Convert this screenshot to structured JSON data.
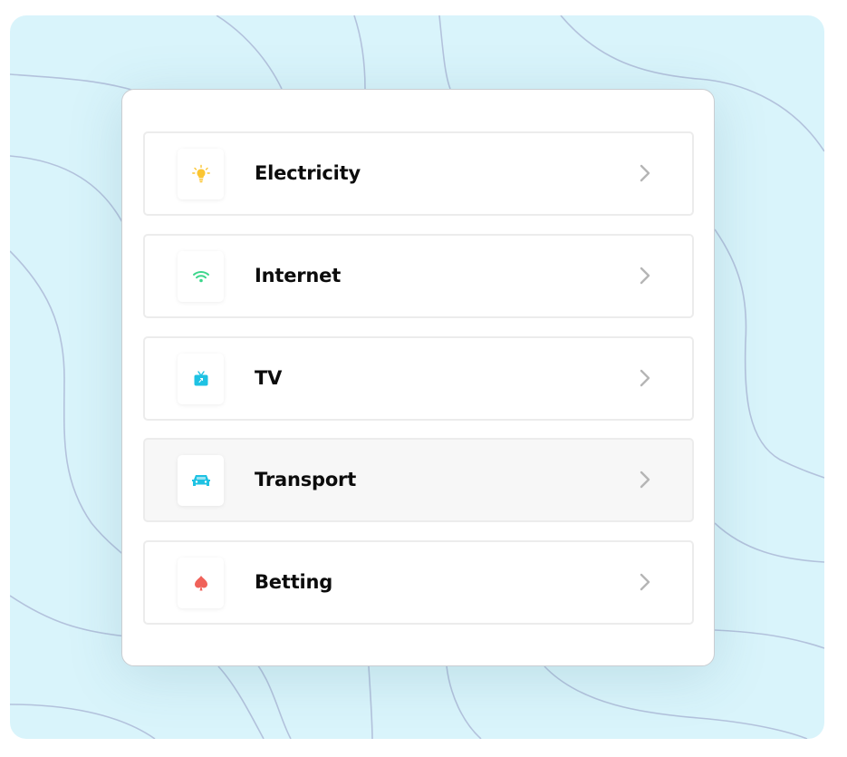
{
  "categories": [
    {
      "label": "Electricity",
      "icon": "lightbulb-icon",
      "color": "#fbc531",
      "highlighted": false
    },
    {
      "label": "Internet",
      "icon": "wifi-icon",
      "color": "#3dd68c",
      "highlighted": false
    },
    {
      "label": "TV",
      "icon": "tv-icon",
      "color": "#1ec2e3",
      "highlighted": false
    },
    {
      "label": "Transport",
      "icon": "car-icon",
      "color": "#1ec2e3",
      "highlighted": true
    },
    {
      "label": "Betting",
      "icon": "spade-icon",
      "color": "#f0625a",
      "highlighted": false
    }
  ],
  "colors": {
    "background": "#d9f4fb",
    "wave_lines": "#b3c2dc",
    "card": "#ffffff",
    "item_border": "#ececec",
    "item_hover": "#f7f7f7",
    "chevron": "#b5b5b5",
    "label": "#0c0c0c"
  }
}
